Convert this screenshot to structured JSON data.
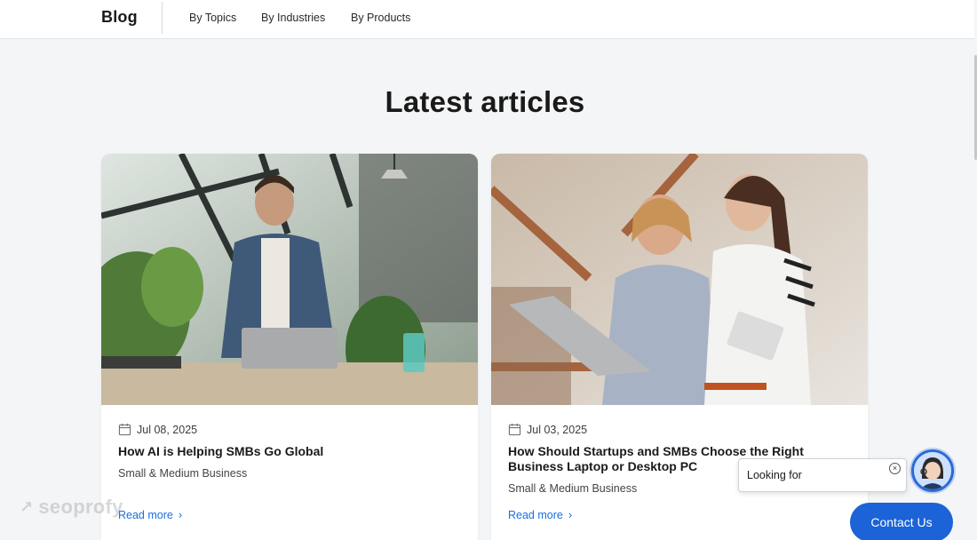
{
  "header": {
    "brand": "Blog",
    "nav": [
      "By Topics",
      "By Industries",
      "By Products"
    ]
  },
  "section": {
    "title": "Latest articles"
  },
  "articles": [
    {
      "date": "Jul 08, 2025",
      "title": "How AI is Helping SMBs Go Global",
      "category": "Small & Medium Business",
      "read_more": "Read more"
    },
    {
      "date": "Jul 03, 2025",
      "title": "How Should Startups and SMBs Choose the Right Business Laptop or Desktop PC",
      "category": "Small & Medium Business",
      "read_more": "Read more"
    }
  ],
  "watermark": "seoprofy",
  "chat": {
    "bubble_text": "Looking for",
    "contact_label": "Contact Us"
  },
  "colors": {
    "accent": "#1b63d6",
    "link": "#1a6fe0",
    "page_bg": "#f4f5f7"
  },
  "icons": [
    "calendar-icon",
    "chevron-right-icon",
    "close-icon",
    "arrow-up-right-icon"
  ]
}
